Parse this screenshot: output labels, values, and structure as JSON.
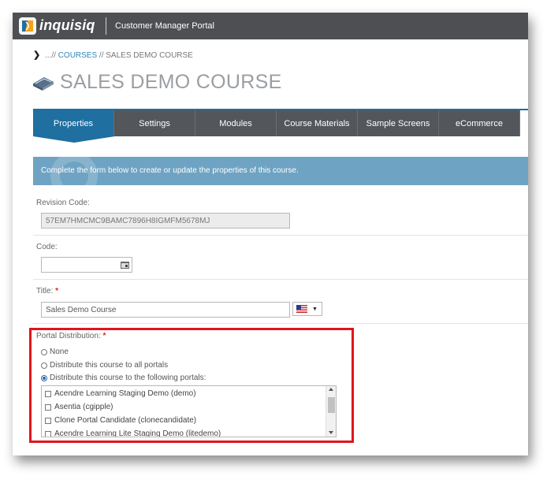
{
  "header": {
    "logo_text": "inquisiq",
    "portal_name": "Customer Manager Portal"
  },
  "breadcrumb": {
    "prefix": "...//",
    "link": "COURSES",
    "separator": "//",
    "current": "SALES DEMO COURSE"
  },
  "page": {
    "title": "SALES DEMO COURSE",
    "title_icon": "book-icon"
  },
  "tabs": [
    {
      "label": "Properties",
      "active": true
    },
    {
      "label": "Settings",
      "active": false
    },
    {
      "label": "Modules",
      "active": false
    },
    {
      "label": "Course Materials",
      "active": false
    },
    {
      "label": "Sample Screens",
      "active": false
    },
    {
      "label": "eCommerce",
      "active": false
    }
  ],
  "banner": {
    "text": "Complete the form below to create or update the properties of this course."
  },
  "form": {
    "revision_code": {
      "label": "Revision Code:",
      "value": "57EM7HMCMC9BAMC7896H8IGMFM5678MJ"
    },
    "code": {
      "label": "Code:",
      "value": "",
      "icon": "calendar-icon"
    },
    "title": {
      "label": "Title:",
      "required_mark": "*",
      "value": "Sales Demo Course",
      "language_icon": "us-flag-icon"
    },
    "portal_distribution": {
      "label": "Portal Distribution:",
      "required_mark": "*",
      "options": [
        {
          "label": "None",
          "checked": false
        },
        {
          "label": "Distribute this course to all portals",
          "checked": false
        },
        {
          "label": "Distribute this course to the following portals:",
          "checked": true
        }
      ],
      "portals": [
        {
          "label": "Acendre Learning Staging Demo (demo)",
          "checked": false
        },
        {
          "label": "Asentia (cgipple)",
          "checked": false
        },
        {
          "label": "Clone Portal Candidate (clonecandidate)",
          "checked": false
        },
        {
          "label": "Acendre Learning Lite Staging Demo (litedemo)",
          "checked": false
        }
      ]
    }
  },
  "colors": {
    "topbar": "#4d4f53",
    "tab_active": "#1f6fa0",
    "tab_inactive": "#53575b",
    "banner": "#6ea3c3",
    "highlight": "#e0141e"
  }
}
